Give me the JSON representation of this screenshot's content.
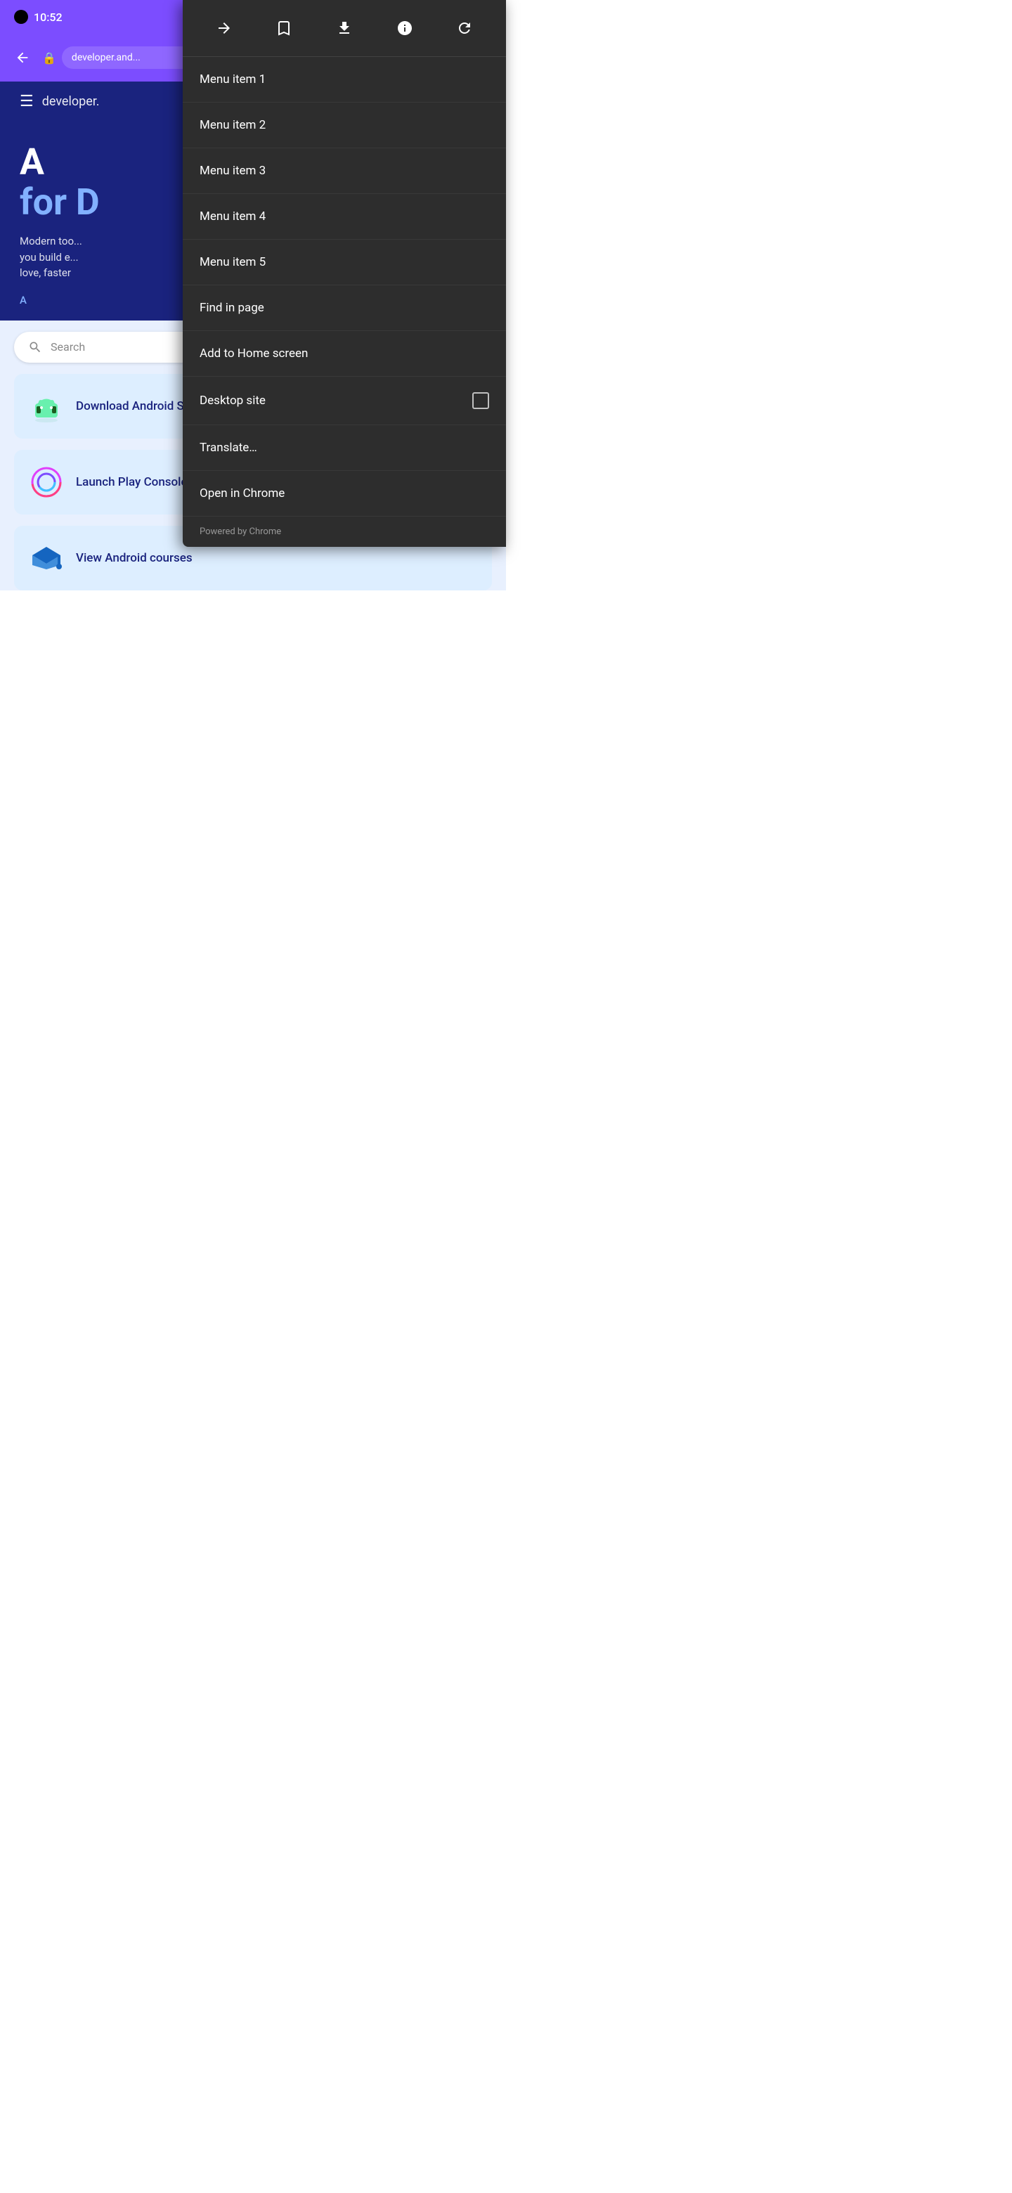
{
  "statusBar": {
    "time": "10:52",
    "bgColor": "#7c4dff"
  },
  "browserToolbar": {
    "backLabel": "←",
    "urlText": "developer.and...",
    "lockIcon": "🔒"
  },
  "devPage": {
    "logoText": "developer.",
    "heroTitle1": "A",
    "heroTitleLine2": "for D",
    "heroSubtitle": "Modern too...\nyou build e...\nlove, faster\nA...",
    "ctaText": "A"
  },
  "searchBar": {
    "placeholder": "Search"
  },
  "cards": [
    {
      "text": "Download Android Studio",
      "iconType": "android",
      "hasArrow": true
    },
    {
      "text": "Launch Play Console",
      "iconType": "play",
      "hasArrow": true
    },
    {
      "text": "View Android courses",
      "iconType": "graduation",
      "hasArrow": false
    }
  ],
  "menu": {
    "toolbar": {
      "forwardIcon": "→",
      "bookmarkIcon": "☆",
      "downloadIcon": "↓",
      "infoIcon": "ⓘ",
      "refreshIcon": "↻"
    },
    "items": [
      {
        "label": "Menu item 1",
        "hasCheckbox": false
      },
      {
        "label": "Menu item 2",
        "hasCheckbox": false
      },
      {
        "label": "Menu item 3",
        "hasCheckbox": false
      },
      {
        "label": "Menu item 4",
        "hasCheckbox": false
      },
      {
        "label": "Menu item 5",
        "hasCheckbox": false
      },
      {
        "label": "Find in page",
        "hasCheckbox": false
      },
      {
        "label": "Add to Home screen",
        "hasCheckbox": false
      },
      {
        "label": "Desktop site",
        "hasCheckbox": true
      },
      {
        "label": "Translate…",
        "hasCheckbox": false
      },
      {
        "label": "Open in Chrome",
        "hasCheckbox": false
      }
    ],
    "footer": "Powered by Chrome",
    "bgColor": "#2d2d2d"
  }
}
